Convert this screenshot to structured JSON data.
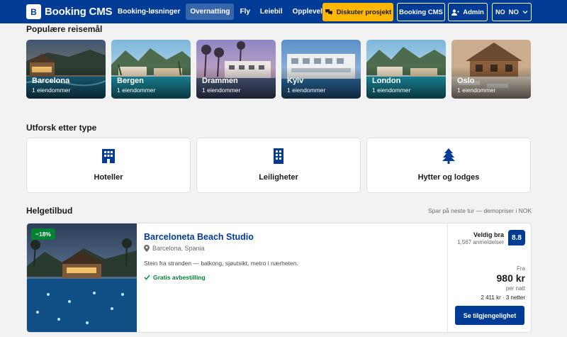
{
  "header": {
    "logo_letter": "B",
    "brand": "Booking CMS",
    "nav": [
      {
        "label": "Booking-løsninger"
      },
      {
        "label": "Overnatting"
      },
      {
        "label": "Fly"
      },
      {
        "label": "Leiebil"
      },
      {
        "label": "Opplevelser"
      }
    ],
    "discuss_label": "Diskuter prosjekt",
    "cms_label": "Booking CMS",
    "admin_label": "Admin",
    "lang_flag": "NO",
    "lang_label": "NO"
  },
  "destinations": {
    "title": "Populære reisemål",
    "items": [
      {
        "name": "Barcelona",
        "count": "1 eiendommer"
      },
      {
        "name": "Bergen",
        "count": "1 eiendommer"
      },
      {
        "name": "Drammen",
        "count": "1 eiendommer"
      },
      {
        "name": "Kyiv",
        "count": "1 eiendommer"
      },
      {
        "name": "London",
        "count": "1 eiendommer"
      },
      {
        "name": "Oslo",
        "count": "1 eiendommer"
      }
    ]
  },
  "types": {
    "title": "Utforsk etter type",
    "items": [
      {
        "label": "Hoteller",
        "icon": "hotel-icon"
      },
      {
        "label": "Leiligheter",
        "icon": "apartment-icon"
      },
      {
        "label": "Hytter og lodges",
        "icon": "tree-icon"
      }
    ]
  },
  "deals": {
    "title": "Helgetilbud",
    "note": "Spar på neste tur — demopriser i NOK",
    "card": {
      "badge": "−18%",
      "title": "Barceloneta Beach Studio",
      "location": "Barcelona, Spania",
      "description": "Stein fra stranden — balkong, sjøutsikt, metro i nærheten.",
      "cancellation": "Gratis avbestilling",
      "rating_word": "Veldig bra",
      "rating_count": "1,567 anmeldelser",
      "score": "8.8",
      "from": "Fra",
      "price": "980 kr",
      "per_night": "per natt",
      "total": "2 411 kr · 3 netter",
      "cta": "Se tilgjengelighet"
    }
  },
  "colors": {
    "brand_blue": "#003b95",
    "accent_yellow": "#ffb700",
    "success_green": "#008234"
  }
}
